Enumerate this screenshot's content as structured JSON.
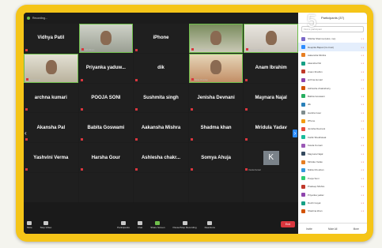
{
  "topbar": {
    "title": "Recording..."
  },
  "tiles": [
    {
      "name": "Vidhya Patil",
      "kind": "name"
    },
    {
      "name": "",
      "kind": "video",
      "bg": "video-bg1",
      "tag": "Vidhi Bharti"
    },
    {
      "name": "iPhone",
      "kind": "name"
    },
    {
      "name": "",
      "kind": "video",
      "bg": "video-bg3",
      "tag": "Kartik Shekhawat"
    },
    {
      "name": "",
      "kind": "video",
      "bg": "video-bg4",
      "tag": "Pradeep Mishra"
    },
    {
      "name": "",
      "kind": "video",
      "bg": "video-bg2",
      "tag": "Ruchi Goyal"
    },
    {
      "name": "Priyanka  yaduw...",
      "kind": "name"
    },
    {
      "name": "dik",
      "kind": "name"
    },
    {
      "name": "",
      "kind": "video",
      "bg": "video-bg6",
      "tag": "Nikita Chouhan"
    },
    {
      "name": "Anam Ibrahim",
      "kind": "name"
    },
    {
      "name": "archna kumari",
      "kind": "name"
    },
    {
      "name": "POOJA SONI",
      "kind": "name"
    },
    {
      "name": "Sushmita singh",
      "kind": "name"
    },
    {
      "name": "Jenisha Devnani",
      "kind": "name"
    },
    {
      "name": "Maynara Najal",
      "kind": "name"
    },
    {
      "name": "Akansha Pal",
      "kind": "name"
    },
    {
      "name": "Babita Goswami",
      "kind": "name"
    },
    {
      "name": "Aakansha Mishra",
      "kind": "name"
    },
    {
      "name": "Shadma khan",
      "kind": "name"
    },
    {
      "name": "Mridula Yadav",
      "kind": "name"
    },
    {
      "name": "Yashvini Verma",
      "kind": "name"
    },
    {
      "name": "Harsha Gour",
      "kind": "name"
    },
    {
      "name": "Ashlesha  chakr...",
      "kind": "name"
    },
    {
      "name": "Somya Ahuja",
      "kind": "name"
    },
    {
      "name": "K",
      "kind": "letter",
      "tag": "Kavita Kumari"
    },
    {
      "name": "",
      "kind": "empty"
    },
    {
      "name": "",
      "kind": "empty"
    },
    {
      "name": "",
      "kind": "empty"
    },
    {
      "name": "",
      "kind": "empty"
    },
    {
      "name": "",
      "kind": "empty"
    }
  ],
  "toolbar": {
    "mute": "Mute",
    "stop_video": "Stop Video",
    "participants": "Participants",
    "chat": "Chat",
    "share_screen": "Share Screen",
    "pause_recording": "Pause/Stop Recording",
    "reactions": "Reactions",
    "end": "End"
  },
  "panel": {
    "title": "Participants (37)",
    "search_placeholder": "Find a participant",
    "footer": [
      "Invite",
      "Mute All",
      "More"
    ],
    "participants": [
      {
        "name": "Shikha Sharma (Host, me)",
        "color": "#7b68c8"
      },
      {
        "name": "Deepika Bapat (Co-host)",
        "color": "#2d8cff"
      },
      {
        "name": "Aakansha Mishra",
        "color": "#e67e22"
      },
      {
        "name": "Akansha Pal",
        "color": "#16a085"
      },
      {
        "name": "Anam Ibrahim",
        "color": "#c0392b"
      },
      {
        "name": "archna kumari",
        "color": "#8e44ad"
      },
      {
        "name": "Ashlesha chakraborty",
        "color": "#d35400"
      },
      {
        "name": "Babita Goswami",
        "color": "#27ae60"
      },
      {
        "name": "dik",
        "color": "#2980b9"
      },
      {
        "name": "Harsha Gour",
        "color": "#7f8c8d"
      },
      {
        "name": "iPhone",
        "color": "#f39c12"
      },
      {
        "name": "Jenisha Devnani",
        "color": "#e74c3c"
      },
      {
        "name": "Kartik Shekhawat",
        "color": "#1abc9c"
      },
      {
        "name": "Kavita Kumari",
        "color": "#9b59b6"
      },
      {
        "name": "Maynara Najal",
        "color": "#34495e"
      },
      {
        "name": "Mridula Yadav",
        "color": "#e67e22"
      },
      {
        "name": "Nikita Chouhan",
        "color": "#3498db"
      },
      {
        "name": "Pooja Soni",
        "color": "#2ecc71"
      },
      {
        "name": "Pradeep Mishra",
        "color": "#c0392b"
      },
      {
        "name": "Priyanka yadav",
        "color": "#8e44ad"
      },
      {
        "name": "Ruchi Goyal",
        "color": "#16a085"
      },
      {
        "name": "Shadma khan",
        "color": "#d35400"
      }
    ]
  },
  "overlay_number": "5"
}
